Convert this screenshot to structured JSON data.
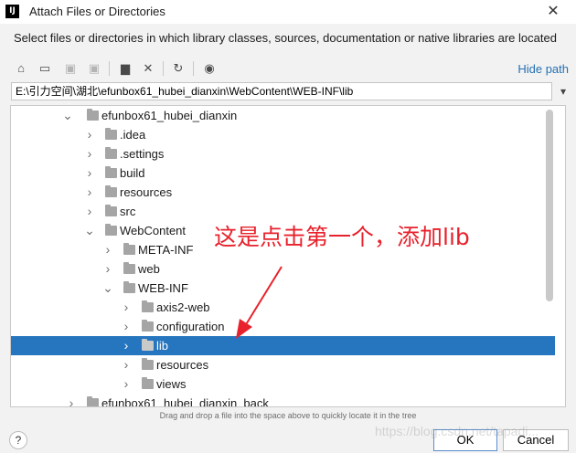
{
  "window": {
    "logo_text": "IJ",
    "title": "Attach Files or Directories",
    "close_glyph": "✕"
  },
  "description": "Select files or directories in which library classes, sources, documentation or native libraries are located",
  "toolbar": {
    "buttons": [
      {
        "name": "home-icon",
        "glyph": "⌂",
        "enabled": true
      },
      {
        "name": "desktop-icon",
        "glyph": "▭",
        "enabled": true
      },
      {
        "name": "project-icon",
        "glyph": "▣",
        "enabled": false
      },
      {
        "name": "module-icon",
        "glyph": "▣",
        "enabled": false
      },
      {
        "name": "new-folder-icon",
        "glyph": "▆",
        "enabled": true
      },
      {
        "name": "delete-icon",
        "glyph": "✕",
        "enabled": true
      },
      {
        "name": "refresh-icon",
        "glyph": "↻",
        "enabled": true
      },
      {
        "name": "show-hidden-icon",
        "glyph": "◉",
        "enabled": true
      }
    ],
    "hide_path_label": "Hide path"
  },
  "path": {
    "value": "E:\\引力空间\\湖北\\efunbox61_hubei_dianxin\\WebContent\\WEB-INF\\lib",
    "history_glyph": "▾"
  },
  "tree": {
    "rows": [
      {
        "label": "efunbox61_hubei_dianxin",
        "expanded": true,
        "depth": 0
      },
      {
        "label": ".idea",
        "expanded": false,
        "depth": 1
      },
      {
        "label": ".settings",
        "expanded": false,
        "depth": 1
      },
      {
        "label": "build",
        "expanded": false,
        "depth": 1
      },
      {
        "label": "resources",
        "expanded": false,
        "depth": 1
      },
      {
        "label": "src",
        "expanded": false,
        "depth": 1
      },
      {
        "label": "WebContent",
        "expanded": true,
        "depth": 1
      },
      {
        "label": "META-INF",
        "expanded": false,
        "depth": 2
      },
      {
        "label": "web",
        "expanded": false,
        "depth": 2
      },
      {
        "label": "WEB-INF",
        "expanded": true,
        "depth": 2
      },
      {
        "label": "axis2-web",
        "expanded": false,
        "depth": 3
      },
      {
        "label": "configuration",
        "expanded": false,
        "depth": 3
      },
      {
        "label": "lib",
        "expanded": false,
        "depth": 3,
        "selected": true
      },
      {
        "label": "resources",
        "expanded": false,
        "depth": 3
      },
      {
        "label": "views",
        "expanded": false,
        "depth": 3
      },
      {
        "label": "efunbox61_hubei_dianxin_back",
        "expanded": false,
        "depth": 0
      }
    ]
  },
  "hint": "Drag and drop a file into the space above to quickly locate it in the tree",
  "annotation": "这是点击第一个，添加lib",
  "buttons": {
    "help": "?",
    "ok": "OK",
    "cancel": "Cancel"
  },
  "watermark": "https://blog.csdn.net/tapadi...",
  "colors": {
    "selection": "#2675bf",
    "link": "#2470b3",
    "annotation": "#e8222c"
  }
}
